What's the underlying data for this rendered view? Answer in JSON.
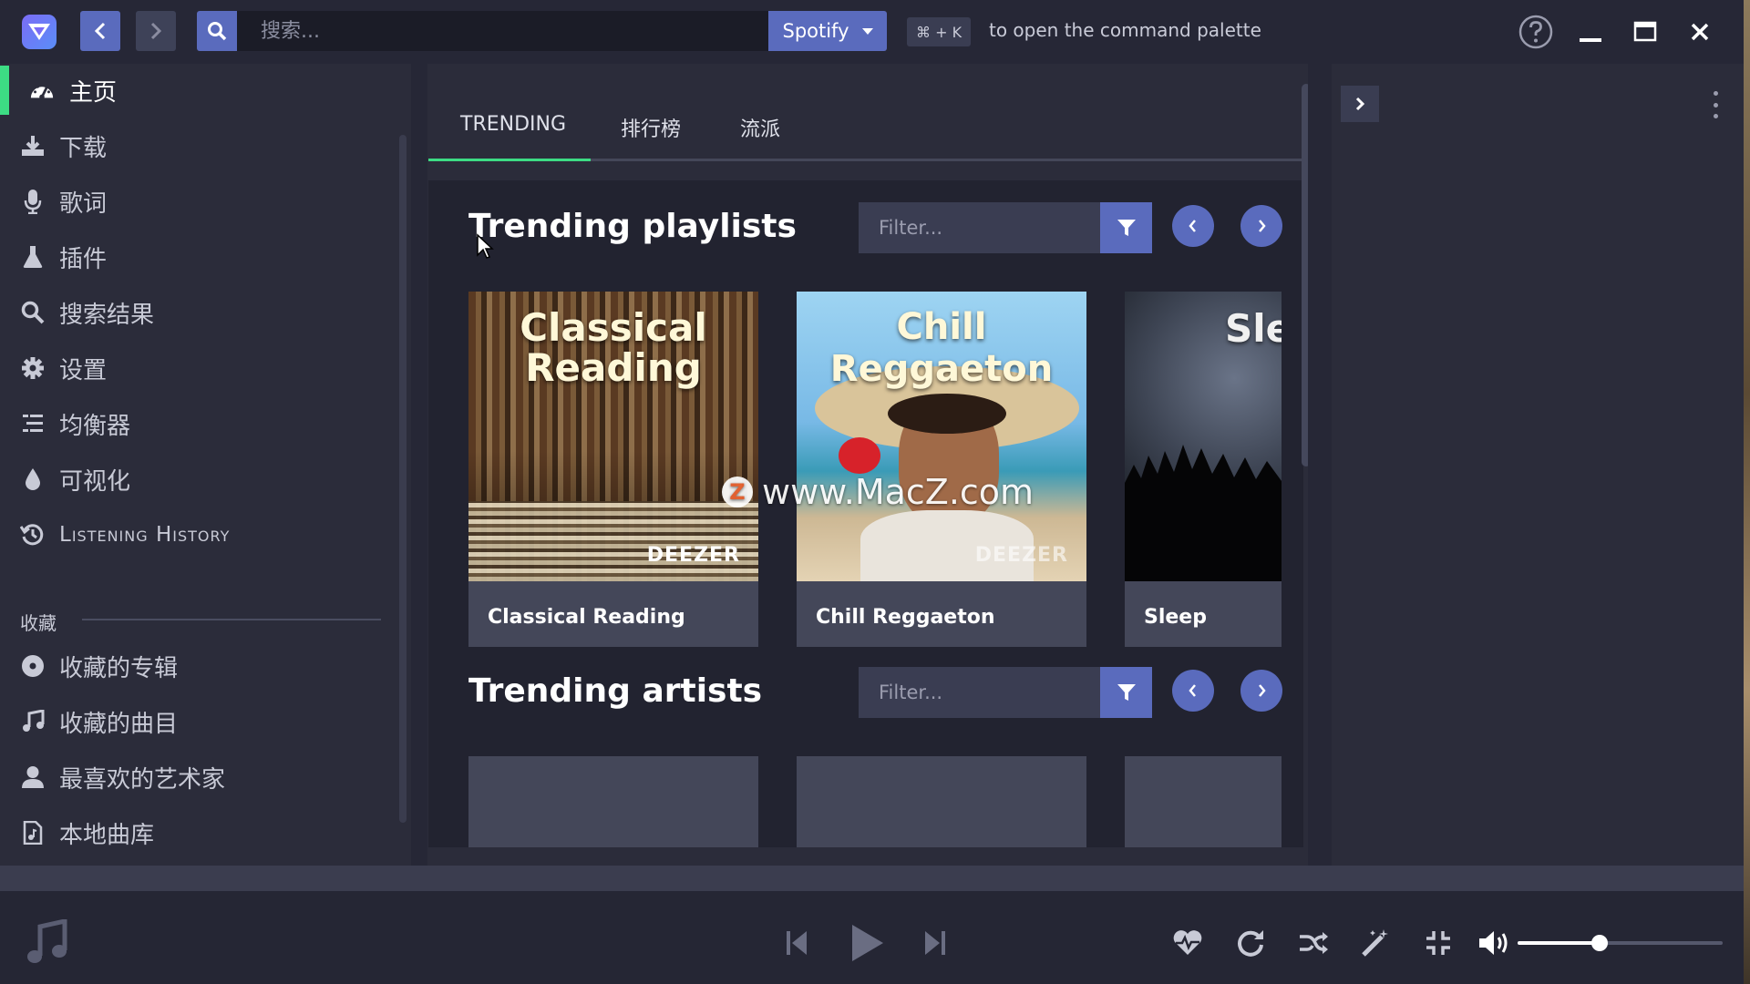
{
  "topbar": {
    "search_placeholder": "搜索...",
    "provider": "Spotify",
    "shortcut_keys": "⌘ + K",
    "shortcut_hint": "to open the command palette"
  },
  "sidebar": {
    "items": [
      {
        "label": "主页",
        "icon": "dashboard-icon"
      },
      {
        "label": "下载",
        "icon": "download-icon"
      },
      {
        "label": "歌词",
        "icon": "microphone-icon"
      },
      {
        "label": "插件",
        "icon": "flask-icon"
      },
      {
        "label": "搜索结果",
        "icon": "search-icon"
      },
      {
        "label": "设置",
        "icon": "gear-icon"
      },
      {
        "label": "均衡器",
        "icon": "equalizer-icon"
      },
      {
        "label": "可视化",
        "icon": "droplet-icon"
      },
      {
        "label": "Listening History",
        "icon": "history-icon"
      }
    ],
    "collection_title": "收藏",
    "collection_items": [
      {
        "label": "收藏的专辑",
        "icon": "disc-icon"
      },
      {
        "label": "收藏的曲目",
        "icon": "music-note-icon"
      },
      {
        "label": "最喜欢的艺术家",
        "icon": "user-icon"
      },
      {
        "label": "本地曲库",
        "icon": "local-file-icon"
      }
    ]
  },
  "tabs": [
    "TRENDING",
    "排行榜",
    "流派"
  ],
  "sections": {
    "playlists": {
      "title": "Trending playlists",
      "filter_placeholder": "Filter...",
      "cards": [
        {
          "caption": "Classical Reading",
          "art_title_1": "Classical",
          "art_title_2": "Reading",
          "brand": "DEEZER"
        },
        {
          "caption": "Chill Reggaeton",
          "art_title_1": "Chill Reggaeton",
          "brand": "DEEZER"
        },
        {
          "caption": "Sleep",
          "art_title_1": "Slee"
        }
      ]
    },
    "artists": {
      "title": "Trending artists",
      "filter_placeholder": "Filter..."
    }
  },
  "watermark": "www.MacZ.com",
  "watermark_badge": "Z",
  "player": {
    "volume": 0.4
  },
  "colors": {
    "accent": "#5a6bbd",
    "active": "#3ddc84",
    "background": "#2b2c3a"
  }
}
